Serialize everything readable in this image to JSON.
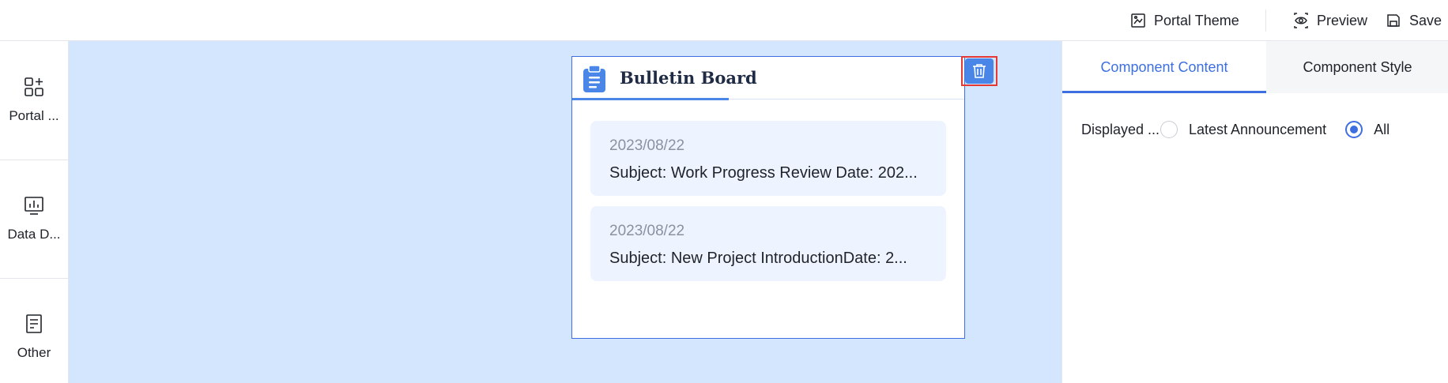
{
  "topbar": {
    "theme_label": "Portal Theme",
    "preview_label": "Preview",
    "save_label": "Save",
    "icons": {
      "theme": "palette-icon",
      "preview": "eye-icon",
      "save": "save-icon"
    }
  },
  "sidebar": {
    "items": [
      {
        "label": "Portal ...",
        "icon": "add-component-icon"
      },
      {
        "label": "Data D...",
        "icon": "chart-icon"
      },
      {
        "label": "Other",
        "icon": "document-icon"
      }
    ]
  },
  "card": {
    "title": "Bulletin Board",
    "icon": "clipboard-icon",
    "notices": [
      {
        "date": "2023/08/22",
        "subject": "Subject: Work Progress Review Date: 202..."
      },
      {
        "date": "2023/08/22",
        "subject": "Subject: New Project IntroductionDate: 2..."
      }
    ],
    "delete_icon": "trash-icon"
  },
  "panel": {
    "tabs": [
      {
        "label": "Component Content",
        "active": true
      },
      {
        "label": "Component Style",
        "active": false
      }
    ],
    "display_option": {
      "label": "Displayed ...",
      "options": [
        {
          "label": "Latest Announcement",
          "checked": false
        },
        {
          "label": "All",
          "checked": true
        }
      ]
    }
  },
  "colors": {
    "accent": "#3d6fe0",
    "canvas_bg": "#d3e6fd",
    "notice_bg": "#eef4ff",
    "highlight_frame": "#e53935"
  }
}
